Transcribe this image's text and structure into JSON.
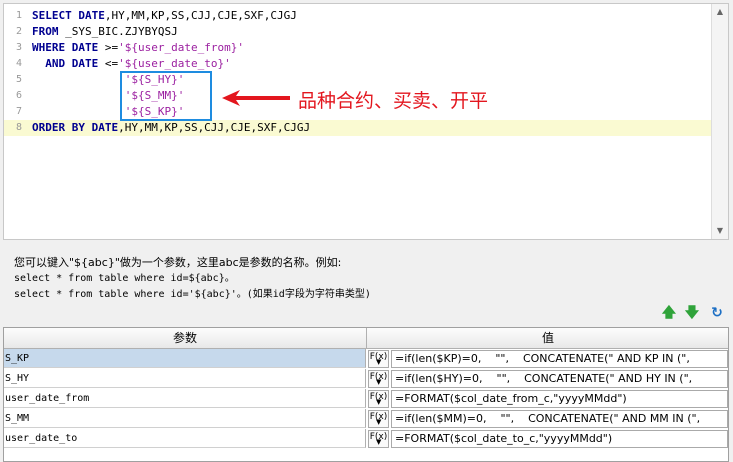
{
  "editor": {
    "lines": [
      {
        "n": "1",
        "parts": [
          {
            "t": "SELECT DATE",
            "c": "kw"
          },
          {
            "t": ",HY,MM,KP,SS,CJJ,CJE,SXF,CJGJ",
            "c": "id"
          }
        ]
      },
      {
        "n": "2",
        "parts": [
          {
            "t": "FROM",
            "c": "kw"
          },
          {
            "t": " _SYS_BIC.ZJYBYQSJ",
            "c": "id"
          }
        ]
      },
      {
        "n": "3",
        "parts": [
          {
            "t": "WHERE DATE",
            "c": "kw"
          },
          {
            "t": " >=",
            "c": "id"
          },
          {
            "t": "'${user_date_from}'",
            "c": "str"
          }
        ]
      },
      {
        "n": "4",
        "parts": [
          {
            "t": "  AND DATE",
            "c": "kw"
          },
          {
            "t": " <=",
            "c": "id"
          },
          {
            "t": "'${user_date_to}'",
            "c": "str"
          }
        ]
      },
      {
        "n": "5",
        "parts": [
          {
            "t": "              '${S_HY}'",
            "c": "str"
          }
        ]
      },
      {
        "n": "6",
        "parts": [
          {
            "t": "              '${S_MM}'",
            "c": "str"
          }
        ]
      },
      {
        "n": "7",
        "parts": [
          {
            "t": "              '${S_KP}'",
            "c": "str"
          }
        ]
      },
      {
        "n": "8",
        "parts": [
          {
            "t": "ORDER BY DATE",
            "c": "kw"
          },
          {
            "t": ",HY,MM,KP,SS,CJJ,CJE,SXF,CJGJ",
            "c": "id"
          }
        ],
        "highlight": true
      }
    ],
    "annotation": "品种合约、买卖、开平",
    "annotation_color": "#e3161e",
    "highlight_box_color": "#1e8ce0"
  },
  "help": {
    "line1": "您可以键入\"${abc}\"做为一个参数，这里abc是参数的名称。例如:",
    "line2": "select * from table where id=${abc}。",
    "line3": "select * from table where id='${abc}'。(如果id字段为字符串类型)"
  },
  "toolbar": {
    "up_icon": "arrow-up-icon",
    "down_icon": "arrow-down-icon",
    "refresh_icon": "refresh-icon"
  },
  "grid": {
    "col_param": "参数",
    "col_value": "值",
    "fx_label": "F(x)",
    "rows": [
      {
        "param": "S_KP",
        "value": "=if(len($KP)=0,    \"\",    CONCATENATE(\" AND KP IN (\",",
        "selected": true
      },
      {
        "param": "S_HY",
        "value": "=if(len($HY)=0,    \"\",    CONCATENATE(\" AND HY IN (\","
      },
      {
        "param": "user_date_from",
        "value": "=FORMAT($col_date_from_c,\"yyyyMMdd\")"
      },
      {
        "param": "S_MM",
        "value": "=if(len($MM)=0,    \"\",    CONCATENATE(\" AND MM IN (\","
      },
      {
        "param": "user_date_to",
        "value": "=FORMAT($col_date_to_c,\"yyyyMMdd\")"
      }
    ]
  }
}
